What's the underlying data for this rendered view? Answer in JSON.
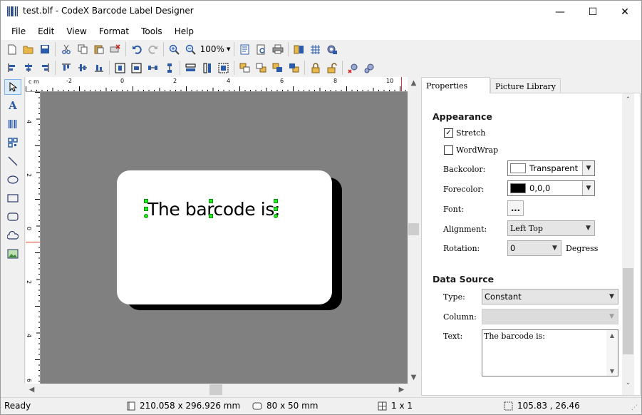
{
  "window": {
    "title": "test.blf - CodeX Barcode Label Designer",
    "minimize": "—",
    "maximize": "☐",
    "close": "✕"
  },
  "menu": [
    {
      "label": "File"
    },
    {
      "label": "Edit"
    },
    {
      "label": "View"
    },
    {
      "label": "Format"
    },
    {
      "label": "Tools"
    },
    {
      "label": "Help"
    }
  ],
  "toolbar": {
    "zoom_value": "100%"
  },
  "ruler": {
    "unit": "c m",
    "h_ticks": [
      "-2",
      "0",
      "2",
      "4",
      "6",
      "8",
      "10"
    ],
    "v_ticks": [
      "4",
      "2",
      "0",
      "2",
      "4",
      "6"
    ]
  },
  "label": {
    "text": "The barcode is:"
  },
  "panel": {
    "tabs": [
      "Properties",
      "Picture Library"
    ],
    "appearance": {
      "title": "Appearance",
      "stretch_label": "Stretch",
      "stretch_checked": true,
      "wordwrap_label": "WordWrap",
      "wordwrap_checked": false,
      "backcolor_label": "Backcolor:",
      "backcolor_value": "Transparent",
      "backcolor_swatch": "#ffffff",
      "forecolor_label": "Forecolor:",
      "forecolor_value": "0,0,0",
      "forecolor_swatch": "#000000",
      "font_label": "Font:",
      "font_button": "...",
      "alignment_label": "Alignment:",
      "alignment_value": "Left Top",
      "rotation_label": "Rotation:",
      "rotation_value": "0",
      "rotation_unit": "Degress"
    },
    "datasource": {
      "title": "Data Source",
      "type_label": "Type:",
      "type_value": "Constant",
      "column_label": "Column:",
      "column_value": "",
      "text_label": "Text:",
      "text_value": "The barcode is:"
    }
  },
  "status": {
    "ready": "Ready",
    "page_size": "210.058 x 296.926 mm",
    "label_size": "80 x 50 mm",
    "layout": "1 x 1",
    "cursor": "105.83 , 26.46"
  }
}
